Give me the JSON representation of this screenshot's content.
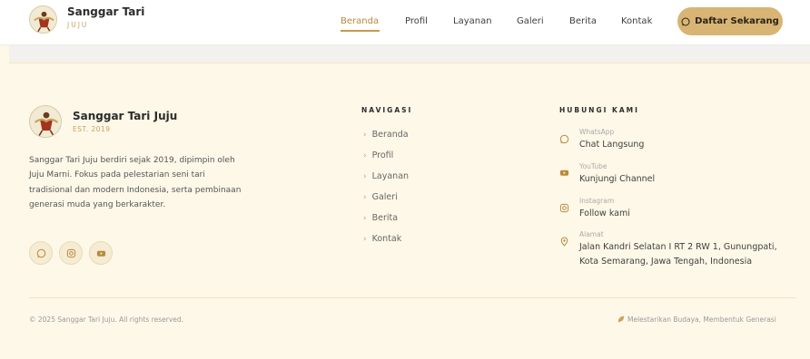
{
  "header": {
    "brand_name": "Sanggar Tari",
    "brand_sub": "JUJU",
    "nav": [
      {
        "label": "Beranda",
        "active": true
      },
      {
        "label": "Profil",
        "active": false
      },
      {
        "label": "Layanan",
        "active": false
      },
      {
        "label": "Galeri",
        "active": false
      },
      {
        "label": "Berita",
        "active": false
      },
      {
        "label": "Kontak",
        "active": false
      }
    ],
    "cta_label": "Daftar Sekarang"
  },
  "footer": {
    "brand_name": "Sanggar Tari Juju",
    "est": "EST. 2019",
    "description": "Sanggar Tari Juju berdiri sejak 2019, dipimpin oleh Juju Marni. Fokus pada pelestarian seni tari tradisional dan modern Indonesia, serta pembinaan generasi muda yang berkarakter.",
    "social": [
      "whatsapp-icon",
      "instagram-icon",
      "youtube-icon"
    ],
    "nav_title": "NAVIGASI",
    "nav_items": [
      "Beranda",
      "Profil",
      "Layanan",
      "Galeri",
      "Berita",
      "Kontak"
    ],
    "contact_title": "HUBUNGI KAMI",
    "contacts": [
      {
        "icon": "whatsapp-icon",
        "label": "WhatsApp",
        "value": "Chat Langsung"
      },
      {
        "icon": "youtube-icon",
        "label": "YouTube",
        "value": "Kunjungi Channel"
      },
      {
        "icon": "instagram-icon",
        "label": "Instagram",
        "value": "Follow kami"
      },
      {
        "icon": "location-icon",
        "label": "Alamat",
        "value": "Jalan Kandri Selatan I RT 2 RW 1, Gunungpati, Kota Semarang, Jawa Tengah, Indonesia"
      }
    ],
    "copyright": "© 2025 Sanggar Tari Juju. All rights reserved.",
    "tagline": "Melestarikan Budaya, Membentuk Generasi"
  },
  "colors": {
    "accent": "#c79a4c",
    "cta_bg": "#d8b574",
    "footer_bg": "#fdf8e8"
  }
}
